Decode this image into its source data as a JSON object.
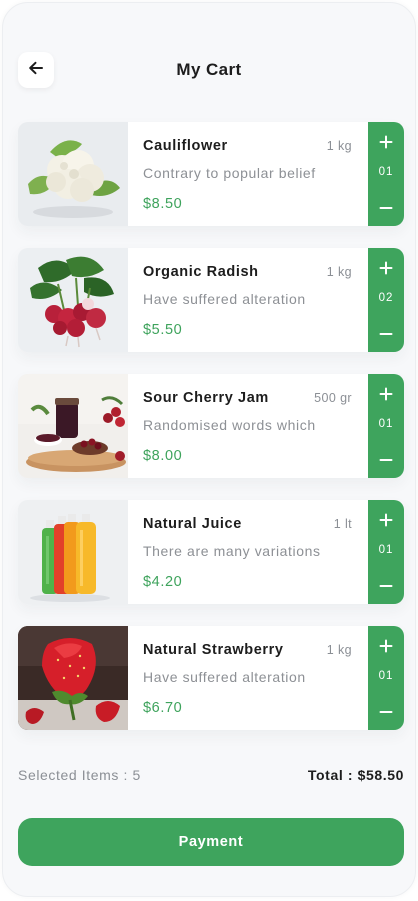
{
  "header": {
    "title": "My Cart",
    "back_icon": "arrow-left-icon"
  },
  "colors": {
    "accent": "#3ea45d",
    "price": "#3ea35c",
    "muted_text": "#8b8f95",
    "background": "#f7f8fa"
  },
  "cart": {
    "items": [
      {
        "name": "Cauliflower",
        "unit": "1 kg",
        "description": "Contrary to popular belief",
        "price": "$8.50",
        "quantity": "01",
        "image": "cauliflower-image"
      },
      {
        "name": "Organic Radish",
        "unit": "1 kg",
        "description": "Have suffered alteration",
        "price": "$5.50",
        "quantity": "02",
        "image": "radish-image"
      },
      {
        "name": "Sour Cherry Jam",
        "unit": "500 gr",
        "description": "Randomised words which",
        "price": "$8.00",
        "quantity": "01",
        "image": "cherry-jam-image"
      },
      {
        "name": "Natural Juice",
        "unit": "1 lt",
        "description": "There are many variations",
        "price": "$4.20",
        "quantity": "01",
        "image": "juice-bottles-image"
      },
      {
        "name": "Natural Strawberry",
        "unit": "1 kg",
        "description": "Have suffered alteration",
        "price": "$6.70",
        "quantity": "01",
        "image": "strawberry-image"
      }
    ],
    "stepper_icons": {
      "plus": "plus-icon",
      "minus": "minus-icon"
    }
  },
  "summary": {
    "selected_label": "Selected Items : 5",
    "total_label": "Total : $58.50"
  },
  "payment": {
    "label": "Payment"
  }
}
